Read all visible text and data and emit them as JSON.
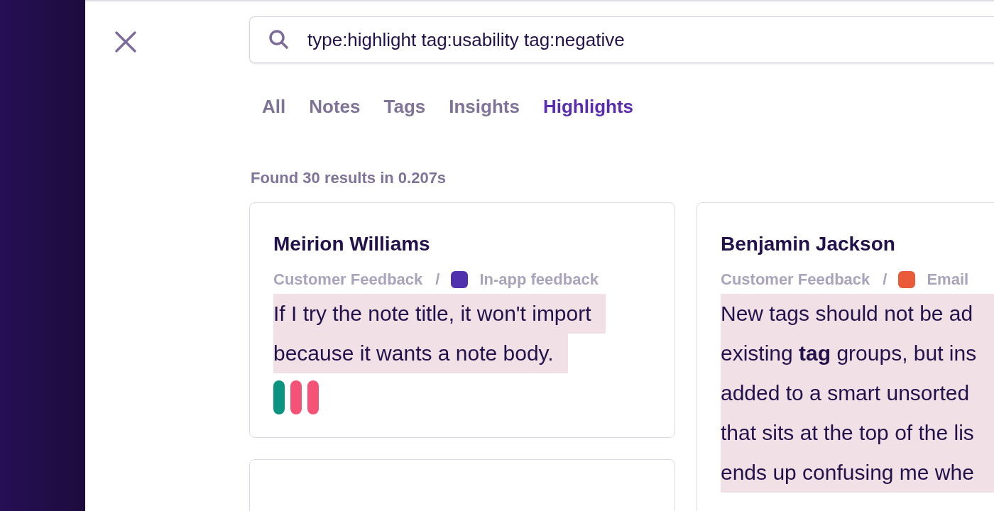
{
  "search": {
    "value": "type:highlight tag:usability tag:negative"
  },
  "tabs": [
    {
      "label": "All",
      "selected": false
    },
    {
      "label": "Notes",
      "selected": false
    },
    {
      "label": "Tags",
      "selected": false
    },
    {
      "label": "Insights",
      "selected": false
    },
    {
      "label": "Highlights",
      "selected": true
    }
  ],
  "result_summary": "Found 30 results in 0.207s",
  "results": [
    {
      "name": "Meirion Williams",
      "project": "Customer Feedback",
      "separator": "/",
      "source": {
        "label": "In-app feedback",
        "color": "#5130ad"
      },
      "lines": [
        "If I try the note title, it won't import",
        "because it wants a note body."
      ],
      "tags": [
        {
          "color": "#0b9482"
        },
        {
          "color": "#f55277"
        },
        {
          "color": "#f55277"
        }
      ]
    },
    {
      "name": "Benjamin Jackson",
      "project": "Customer Feedback",
      "separator": "/",
      "source": {
        "label": "Email",
        "color": "#e85a38"
      },
      "lines": [
        "New tags should not be ad",
        "existing **tag** groups, but ins",
        "added to a smart unsorted",
        "that sits at the top of the lis",
        "ends up confusing me whe"
      ]
    }
  ]
}
